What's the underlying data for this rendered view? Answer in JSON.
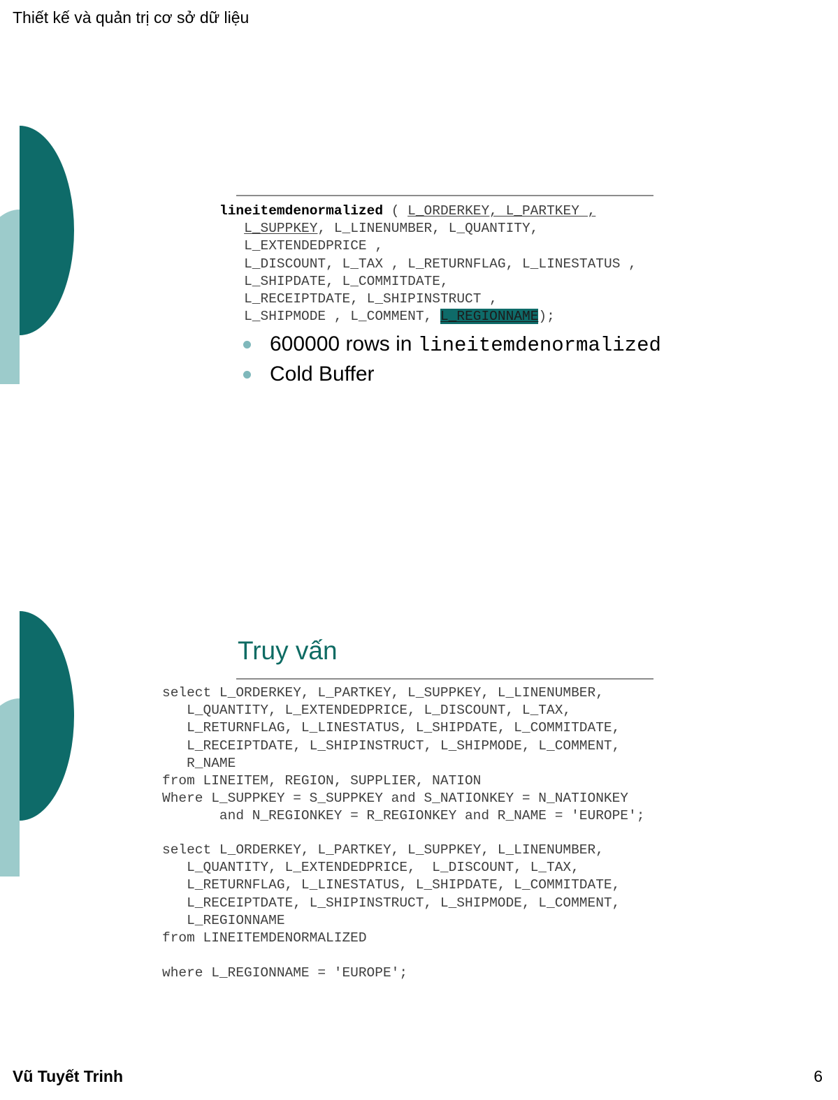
{
  "page": {
    "header_title": "Thiết kế và quản trị cơ sở dữ liệu",
    "footer_author": "Vũ Tuyết Trinh",
    "footer_page_number": "6"
  },
  "colors": {
    "teal_dark": "#0E6B69",
    "teal_light": "#9CCBCB",
    "title_teal": "#0E6B63",
    "bullet_dot": "#7FB8BB",
    "rule_gray": "#8C8C8C",
    "code_gray": "#3F3F3F",
    "highlight_bg": "#0E6B69"
  },
  "slide1": {
    "schema": {
      "table_name": "lineitemdenormalized",
      "open_paren": " ( ",
      "pk_columns": "L_ORDERKEY, L_PARTKEY ,",
      "line2_underlined": "L_SUPPKEY",
      "line2_rest": ", L_LINENUMBER, L_QUANTITY,",
      "line3": "L_EXTENDEDPRICE ,",
      "line4": "L_DISCOUNT, L_TAX , L_RETURNFLAG, L_LINESTATUS ,",
      "line5": "L_SHIPDATE, L_COMMITDATE,",
      "line6": "L_RECEIPTDATE, L_SHIPINSTRUCT ,",
      "line7_prefix": "L_SHIPMODE , L_COMMENT, ",
      "highlighted_column": "L_REGIONNAME",
      "line7_suffix": ");"
    },
    "bullets": [
      {
        "plain": "600000 rows in ",
        "mono": "lineitemdenormalized"
      },
      {
        "plain": "Cold Buffer",
        "mono": ""
      }
    ]
  },
  "slide2": {
    "title": "Truy vấn",
    "query1": [
      "select L_ORDERKEY, L_PARTKEY, L_SUPPKEY, L_LINENUMBER,",
      "   L_QUANTITY, L_EXTENDEDPRICE, L_DISCOUNT, L_TAX,",
      "   L_RETURNFLAG, L_LINESTATUS, L_SHIPDATE, L_COMMITDATE,",
      "   L_RECEIPTDATE, L_SHIPINSTRUCT, L_SHIPMODE, L_COMMENT,",
      "   R_NAME",
      "from LINEITEM, REGION, SUPPLIER, NATION",
      "Where L_SUPPKEY = S_SUPPKEY and S_NATIONKEY = N_NATIONKEY",
      "       and N_REGIONKEY = R_REGIONKEY and R_NAME = 'EUROPE';"
    ],
    "query2": [
      "select L_ORDERKEY, L_PARTKEY, L_SUPPKEY, L_LINENUMBER,",
      "   L_QUANTITY, L_EXTENDEDPRICE,  L_DISCOUNT, L_TAX,",
      "   L_RETURNFLAG, L_LINESTATUS, L_SHIPDATE, L_COMMITDATE,",
      "   L_RECEIPTDATE, L_SHIPINSTRUCT, L_SHIPMODE, L_COMMENT,",
      "   L_REGIONNAME",
      "from LINEITEMDENORMALIZED",
      "",
      "where L_REGIONNAME = 'EUROPE';"
    ]
  }
}
